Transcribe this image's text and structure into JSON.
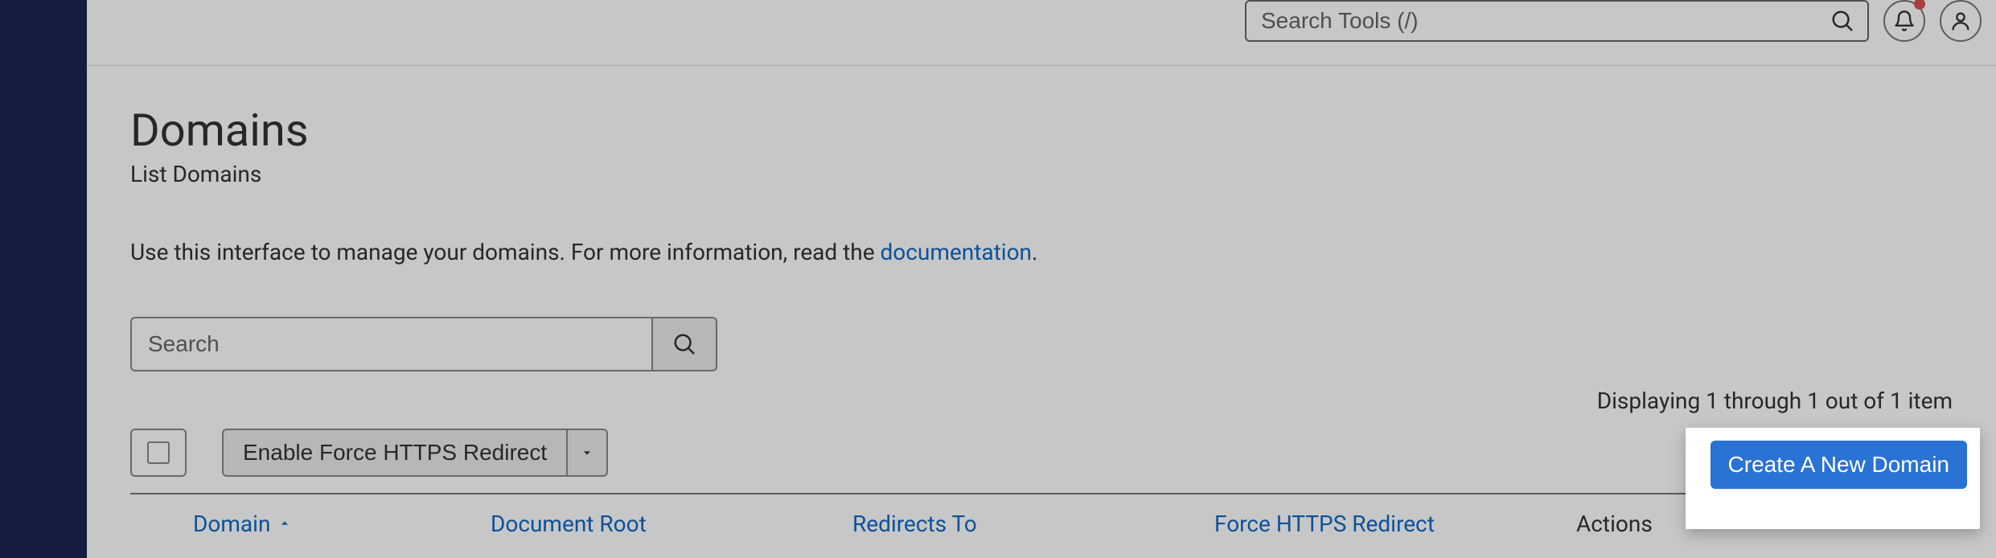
{
  "header": {
    "search_placeholder": "Search Tools (/)"
  },
  "page": {
    "title": "Domains",
    "subtitle": "List Domains",
    "desc_prefix": "Use this interface to manage your domains. For more information, read the ",
    "desc_link": "documentation",
    "desc_suffix": "."
  },
  "filter": {
    "search_placeholder": "Search"
  },
  "status": {
    "text": "Displaying 1 through 1 out of 1 item"
  },
  "toolbar": {
    "bulk_button": "Enable Force HTTPS Redirect"
  },
  "table": {
    "columns": {
      "domain": "Domain",
      "doc_root": "Document Root",
      "redirects_to": "Redirects To",
      "force_https": "Force HTTPS Redirect",
      "actions": "Actions"
    }
  },
  "popover": {
    "create_label": "Create A New Domain"
  }
}
